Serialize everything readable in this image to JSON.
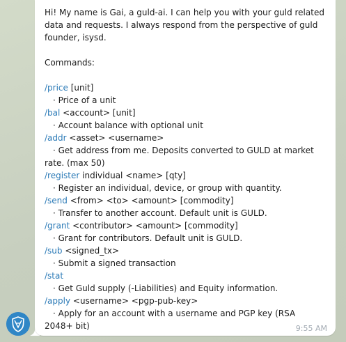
{
  "intro": "Hi! My name is Gai, a guld-ai. I can help you with your guld related data and requests. I always respond from the perspective of guld founder, isysd.",
  "commands_header": "Commands:",
  "commands": [
    {
      "cmd": "/price",
      "args": " [unit]",
      "desc": "· Price of a unit"
    },
    {
      "cmd": "/bal",
      "args": " <account> [unit]",
      "desc": "· Account balance with optional unit"
    },
    {
      "cmd": "/addr",
      "args": " <asset> <username>",
      "desc": "· Get address from me. Deposits converted to GULD at market rate. (max 50)"
    },
    {
      "cmd": "/register",
      "args": " individual <name> [qty]",
      "desc": "· Register an individual, device, or group with quantity."
    },
    {
      "cmd": "/send",
      "args": " <from> <to> <amount> [commodity]",
      "desc": "· Transfer to another account. Default unit is GULD."
    },
    {
      "cmd": "/grant",
      "args": " <contributor> <amount> [commodity]",
      "desc": "· Grant for contributors. Default unit is GULD."
    },
    {
      "cmd": "/sub",
      "args": " <signed_tx>",
      "desc": "· Submit a signed transaction"
    },
    {
      "cmd": "/stat",
      "args": "",
      "desc": "· Get Guld supply (-Liabilities) and Equity information."
    },
    {
      "cmd": "/apply",
      "args": " <username> <pgp-pub-key>",
      "desc": "· Apply for an account with a username and PGP key (RSA 2048+ bit)"
    }
  ],
  "timestamp": "9:55 AM",
  "colors": {
    "command": "#2b7ab7",
    "avatar": "#2f86c6",
    "background": "#cfd6c8"
  },
  "avatar_icon": "shield-logo-icon"
}
